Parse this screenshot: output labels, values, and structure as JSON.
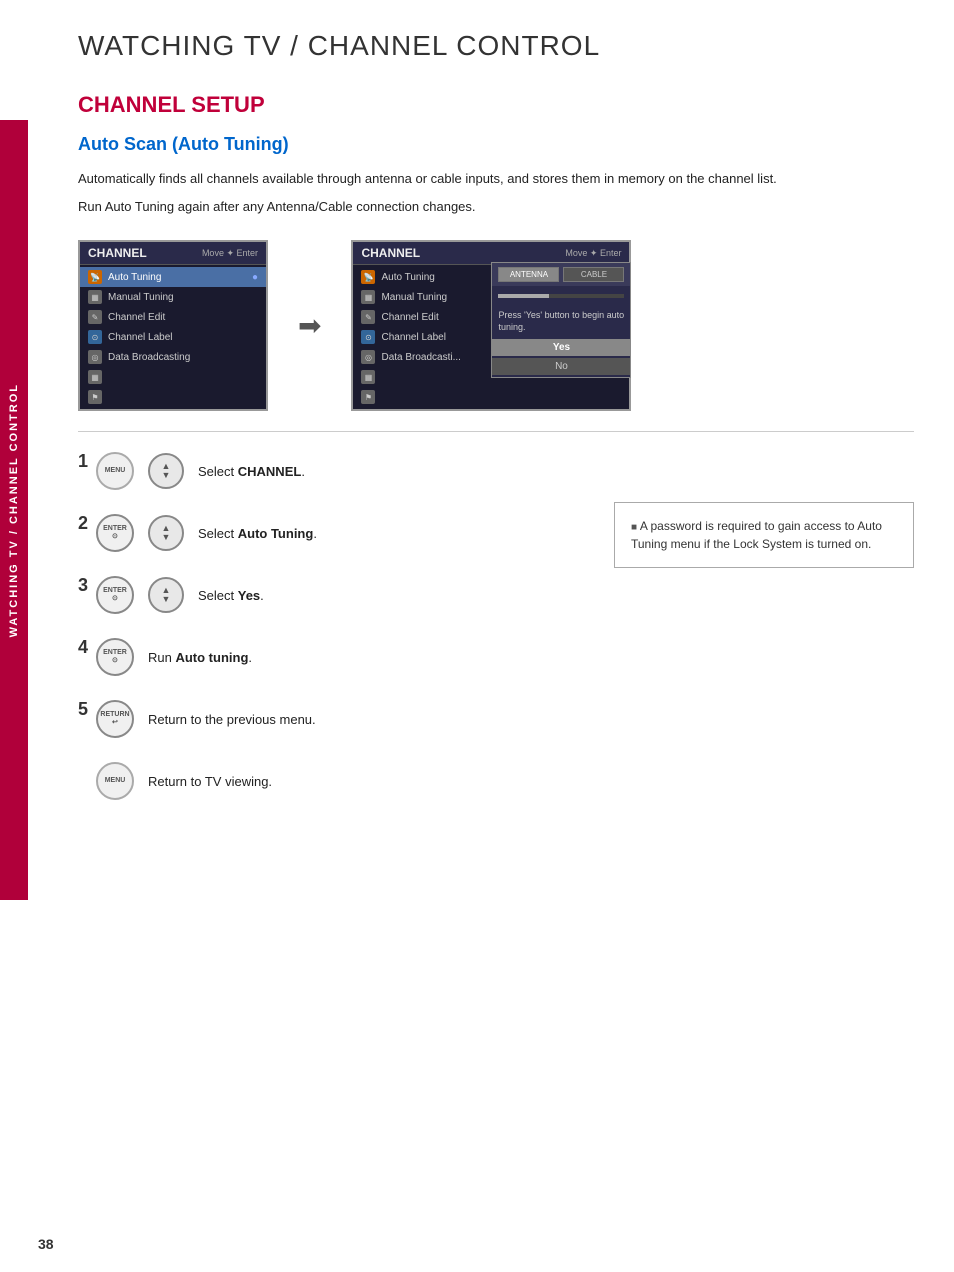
{
  "page": {
    "title": "WATCHING TV / CHANNEL CONTROL",
    "section": "CHANNEL SETUP",
    "subsection": "Auto Scan (Auto Tuning)",
    "description1": "Automatically finds all channels available through antenna or cable inputs, and stores them in memory on the channel list.",
    "description2": "Run Auto Tuning again after any Antenna/Cable connection changes.",
    "page_number": "38"
  },
  "side_tab": {
    "label": "WATCHING TV / CHANNEL CONTROL"
  },
  "tv_menu_left": {
    "header": "CHANNEL",
    "nav_hint": "Move  ✦ Enter",
    "items": [
      {
        "label": "Auto Tuning",
        "selected": true
      },
      {
        "label": "Manual Tuning",
        "selected": false
      },
      {
        "label": "Channel Edit",
        "selected": false
      },
      {
        "label": "Channel Label",
        "selected": false
      },
      {
        "label": "Data Broadcasting",
        "selected": false
      }
    ]
  },
  "tv_menu_right": {
    "header": "CHANNEL",
    "nav_hint": "Move  ✦ Enter",
    "items": [
      {
        "label": "Auto Tuning",
        "selected": false
      },
      {
        "label": "Manual Tuning",
        "selected": false
      },
      {
        "label": "Channel Edit",
        "selected": false
      },
      {
        "label": "Channel Label",
        "selected": false
      },
      {
        "label": "Data Broadcasti...",
        "selected": false
      }
    ],
    "popup": {
      "antenna_label": "ANTENNA",
      "cable_label": "CABLE",
      "prompt_text": "Press 'Yes' button to begin auto tuning.",
      "yes_label": "Yes",
      "no_label": "No"
    }
  },
  "steps": [
    {
      "num": "1",
      "button": "MENU",
      "has_nav": true,
      "text": "Select ",
      "bold": "CHANNEL",
      "suffix": "."
    },
    {
      "num": "2",
      "button": "ENTER",
      "has_nav": true,
      "text": "Select ",
      "bold": "Auto Tuning",
      "suffix": "."
    },
    {
      "num": "3",
      "button": "ENTER",
      "has_nav": true,
      "text": "Select ",
      "bold": "Yes",
      "suffix": "."
    },
    {
      "num": "4",
      "button": "ENTER",
      "has_nav": false,
      "text": "Run ",
      "bold": "Auto tuning",
      "suffix": "."
    },
    {
      "num": "5",
      "button": "RETURN",
      "has_nav": false,
      "text": "Return to the previous menu.",
      "bold": "",
      "suffix": ""
    },
    {
      "num": "",
      "button": "MENU",
      "has_nav": false,
      "text": "Return to TV viewing.",
      "bold": "",
      "suffix": ""
    }
  ],
  "note": "A password is required to gain access to Auto Tuning menu if the Lock System is turned on."
}
